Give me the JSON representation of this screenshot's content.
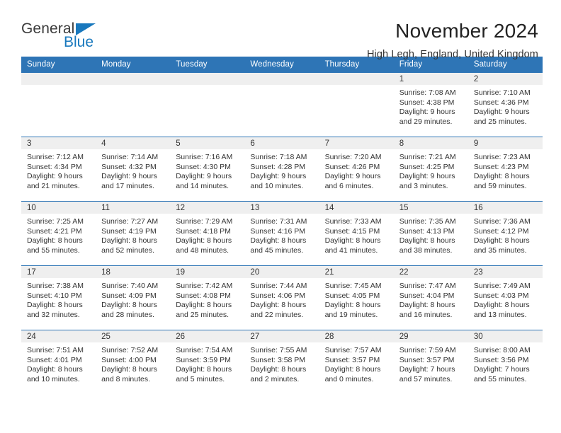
{
  "logo": {
    "primary_text": "General",
    "secondary_text": "Blue",
    "triangle_icon": "triangle-icon",
    "brand_color": "#1878bd"
  },
  "header": {
    "title": "November 2024",
    "subtitle": "High Legh, England, United Kingdom",
    "accent_color": "#2e75b6",
    "daynum_band_color": "#efefef"
  },
  "weekday_headers": [
    "Sunday",
    "Monday",
    "Tuesday",
    "Wednesday",
    "Thursday",
    "Friday",
    "Saturday"
  ],
  "weeks": [
    [
      {
        "day": "",
        "empty": true
      },
      {
        "day": "",
        "empty": true
      },
      {
        "day": "",
        "empty": true
      },
      {
        "day": "",
        "empty": true
      },
      {
        "day": "",
        "empty": true
      },
      {
        "day": "1",
        "sunrise": "Sunrise: 7:08 AM",
        "sunset": "Sunset: 4:38 PM",
        "daylight": "Daylight: 9 hours and 29 minutes."
      },
      {
        "day": "2",
        "sunrise": "Sunrise: 7:10 AM",
        "sunset": "Sunset: 4:36 PM",
        "daylight": "Daylight: 9 hours and 25 minutes."
      }
    ],
    [
      {
        "day": "3",
        "sunrise": "Sunrise: 7:12 AM",
        "sunset": "Sunset: 4:34 PM",
        "daylight": "Daylight: 9 hours and 21 minutes."
      },
      {
        "day": "4",
        "sunrise": "Sunrise: 7:14 AM",
        "sunset": "Sunset: 4:32 PM",
        "daylight": "Daylight: 9 hours and 17 minutes."
      },
      {
        "day": "5",
        "sunrise": "Sunrise: 7:16 AM",
        "sunset": "Sunset: 4:30 PM",
        "daylight": "Daylight: 9 hours and 14 minutes."
      },
      {
        "day": "6",
        "sunrise": "Sunrise: 7:18 AM",
        "sunset": "Sunset: 4:28 PM",
        "daylight": "Daylight: 9 hours and 10 minutes."
      },
      {
        "day": "7",
        "sunrise": "Sunrise: 7:20 AM",
        "sunset": "Sunset: 4:26 PM",
        "daylight": "Daylight: 9 hours and 6 minutes."
      },
      {
        "day": "8",
        "sunrise": "Sunrise: 7:21 AM",
        "sunset": "Sunset: 4:25 PM",
        "daylight": "Daylight: 9 hours and 3 minutes."
      },
      {
        "day": "9",
        "sunrise": "Sunrise: 7:23 AM",
        "sunset": "Sunset: 4:23 PM",
        "daylight": "Daylight: 8 hours and 59 minutes."
      }
    ],
    [
      {
        "day": "10",
        "sunrise": "Sunrise: 7:25 AM",
        "sunset": "Sunset: 4:21 PM",
        "daylight": "Daylight: 8 hours and 55 minutes."
      },
      {
        "day": "11",
        "sunrise": "Sunrise: 7:27 AM",
        "sunset": "Sunset: 4:19 PM",
        "daylight": "Daylight: 8 hours and 52 minutes."
      },
      {
        "day": "12",
        "sunrise": "Sunrise: 7:29 AM",
        "sunset": "Sunset: 4:18 PM",
        "daylight": "Daylight: 8 hours and 48 minutes."
      },
      {
        "day": "13",
        "sunrise": "Sunrise: 7:31 AM",
        "sunset": "Sunset: 4:16 PM",
        "daylight": "Daylight: 8 hours and 45 minutes."
      },
      {
        "day": "14",
        "sunrise": "Sunrise: 7:33 AM",
        "sunset": "Sunset: 4:15 PM",
        "daylight": "Daylight: 8 hours and 41 minutes."
      },
      {
        "day": "15",
        "sunrise": "Sunrise: 7:35 AM",
        "sunset": "Sunset: 4:13 PM",
        "daylight": "Daylight: 8 hours and 38 minutes."
      },
      {
        "day": "16",
        "sunrise": "Sunrise: 7:36 AM",
        "sunset": "Sunset: 4:12 PM",
        "daylight": "Daylight: 8 hours and 35 minutes."
      }
    ],
    [
      {
        "day": "17",
        "sunrise": "Sunrise: 7:38 AM",
        "sunset": "Sunset: 4:10 PM",
        "daylight": "Daylight: 8 hours and 32 minutes."
      },
      {
        "day": "18",
        "sunrise": "Sunrise: 7:40 AM",
        "sunset": "Sunset: 4:09 PM",
        "daylight": "Daylight: 8 hours and 28 minutes."
      },
      {
        "day": "19",
        "sunrise": "Sunrise: 7:42 AM",
        "sunset": "Sunset: 4:08 PM",
        "daylight": "Daylight: 8 hours and 25 minutes."
      },
      {
        "day": "20",
        "sunrise": "Sunrise: 7:44 AM",
        "sunset": "Sunset: 4:06 PM",
        "daylight": "Daylight: 8 hours and 22 minutes."
      },
      {
        "day": "21",
        "sunrise": "Sunrise: 7:45 AM",
        "sunset": "Sunset: 4:05 PM",
        "daylight": "Daylight: 8 hours and 19 minutes."
      },
      {
        "day": "22",
        "sunrise": "Sunrise: 7:47 AM",
        "sunset": "Sunset: 4:04 PM",
        "daylight": "Daylight: 8 hours and 16 minutes."
      },
      {
        "day": "23",
        "sunrise": "Sunrise: 7:49 AM",
        "sunset": "Sunset: 4:03 PM",
        "daylight": "Daylight: 8 hours and 13 minutes."
      }
    ],
    [
      {
        "day": "24",
        "sunrise": "Sunrise: 7:51 AM",
        "sunset": "Sunset: 4:01 PM",
        "daylight": "Daylight: 8 hours and 10 minutes."
      },
      {
        "day": "25",
        "sunrise": "Sunrise: 7:52 AM",
        "sunset": "Sunset: 4:00 PM",
        "daylight": "Daylight: 8 hours and 8 minutes."
      },
      {
        "day": "26",
        "sunrise": "Sunrise: 7:54 AM",
        "sunset": "Sunset: 3:59 PM",
        "daylight": "Daylight: 8 hours and 5 minutes."
      },
      {
        "day": "27",
        "sunrise": "Sunrise: 7:55 AM",
        "sunset": "Sunset: 3:58 PM",
        "daylight": "Daylight: 8 hours and 2 minutes."
      },
      {
        "day": "28",
        "sunrise": "Sunrise: 7:57 AM",
        "sunset": "Sunset: 3:57 PM",
        "daylight": "Daylight: 8 hours and 0 minutes."
      },
      {
        "day": "29",
        "sunrise": "Sunrise: 7:59 AM",
        "sunset": "Sunset: 3:57 PM",
        "daylight": "Daylight: 7 hours and 57 minutes."
      },
      {
        "day": "30",
        "sunrise": "Sunrise: 8:00 AM",
        "sunset": "Sunset: 3:56 PM",
        "daylight": "Daylight: 7 hours and 55 minutes."
      }
    ]
  ]
}
